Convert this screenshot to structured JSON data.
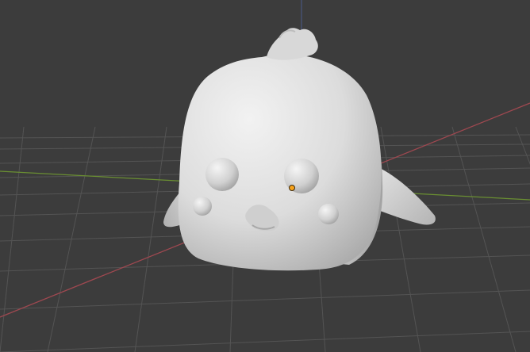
{
  "viewport": {
    "type": "blender-3d-viewport",
    "shading": "solid"
  },
  "colors": {
    "background": "#3c3c3c",
    "grid_line": "#555555",
    "x_axis": "#a04a50",
    "y_axis": "#6a8f32",
    "z_axis": "#4a5a8a",
    "mesh_light": "#e6e6e6",
    "mesh_shadow": "#a9a9a9",
    "origin_point": "#f7a21b"
  },
  "scene": {
    "object_icon": "mesh-object-icon",
    "origin_icon": "object-origin-icon"
  }
}
